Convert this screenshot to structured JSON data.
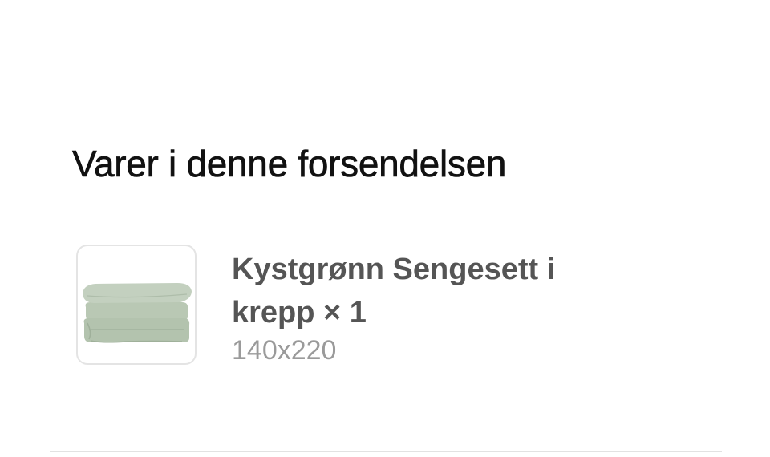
{
  "shipment": {
    "title": "Varer i denne forsendelsen",
    "items": [
      {
        "name": "Kystgrønn Sengesett i krepp",
        "quantity": "× 1",
        "variant": "140x220",
        "thumbnail_icon": "bedding-set-image",
        "thumbnail_color": "#b7c6b2"
      }
    ]
  }
}
